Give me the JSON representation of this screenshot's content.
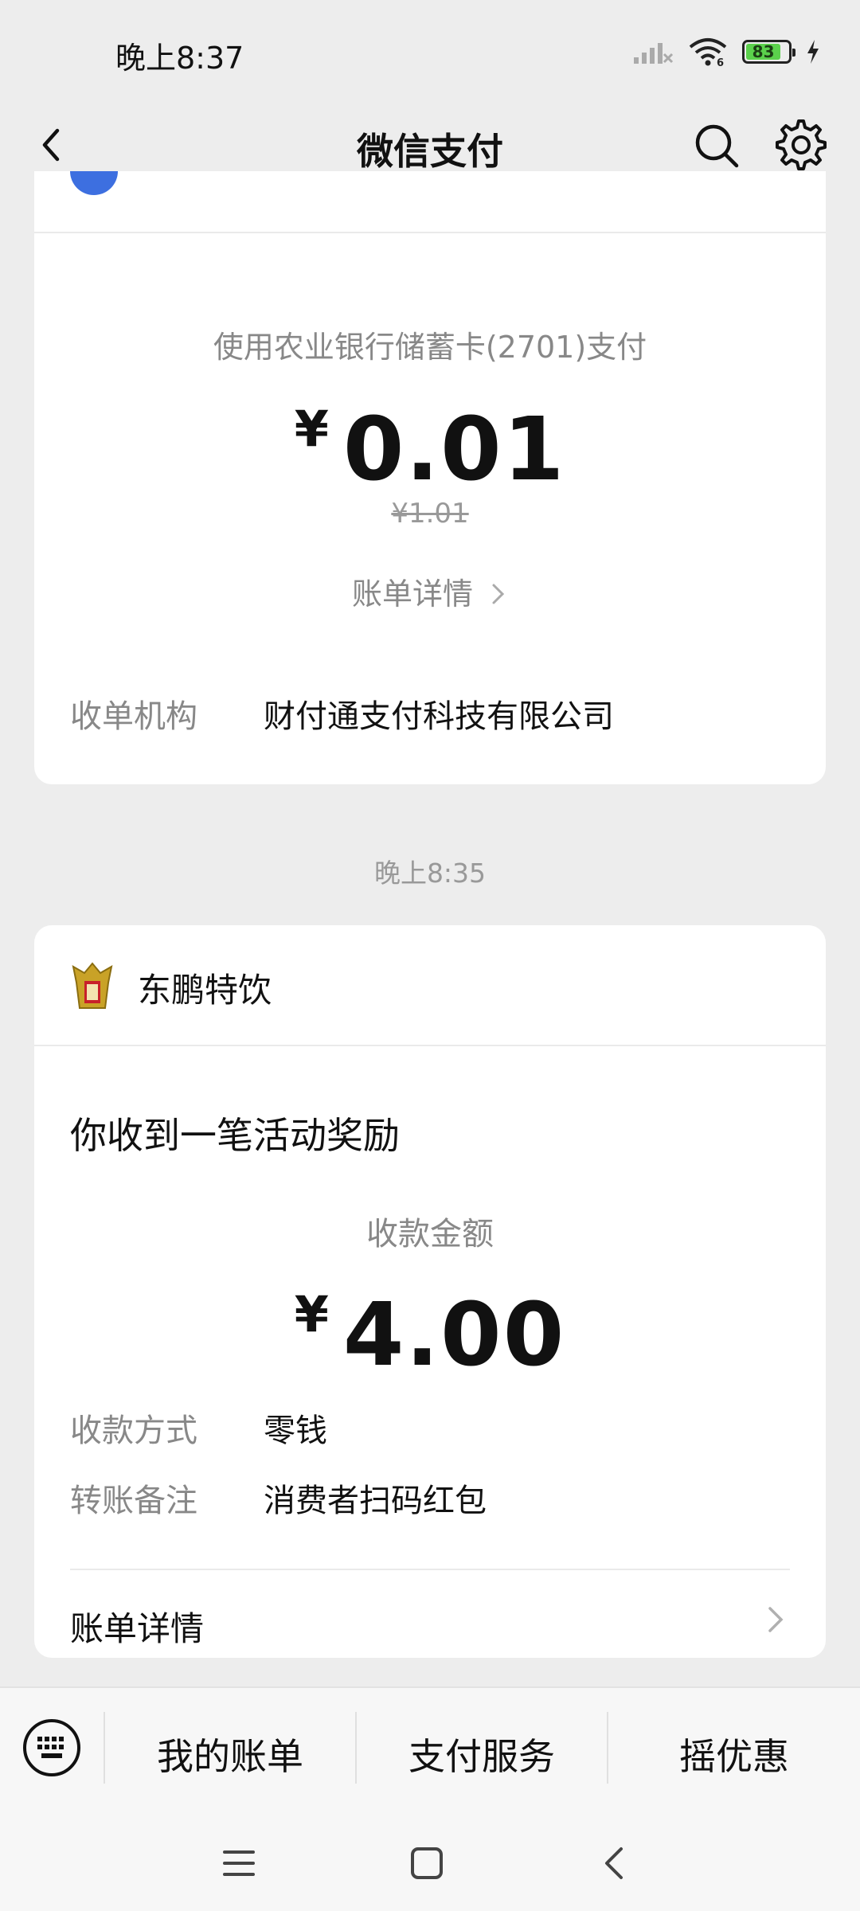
{
  "status_bar": {
    "time": "晚上8:37",
    "battery_level": "83",
    "battery_fraction": 0.83,
    "accent_green": "#5bd14c"
  },
  "header": {
    "title": "微信支付"
  },
  "payment_card": {
    "pay_method": "使用农业银行储蓄卡(2701)支付",
    "currency": "¥",
    "amount": "0.01",
    "original_price": "¥1.01",
    "bill_detail_link": "账单详情",
    "acquirer_label": "收单机构",
    "acquirer_value": "财付通支付科技有限公司"
  },
  "timestamp": "晚上8:35",
  "reward_card": {
    "merchant_name": "东鹏特饮",
    "title": "你收到一笔活动奖励",
    "receive_label": "收款金额",
    "currency": "¥",
    "amount": "4.00",
    "method_label": "收款方式",
    "method_value": "零钱",
    "note_label": "转账备注",
    "note_value": "消费者扫码红包",
    "bill_detail": "账单详情"
  },
  "bottom_menu": {
    "items": [
      "我的账单",
      "支付服务",
      "摇优惠"
    ]
  }
}
